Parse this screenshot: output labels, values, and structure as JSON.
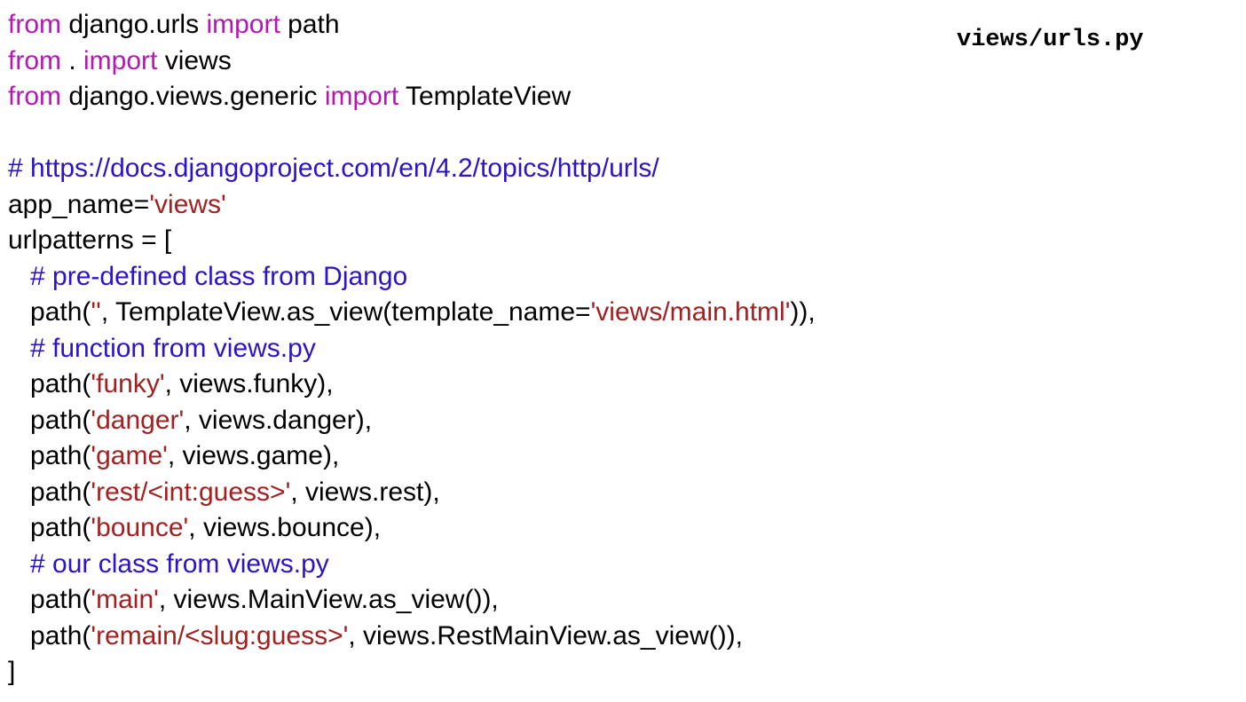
{
  "filename": "views/urls.py",
  "colors": {
    "keyword": "#b517b5",
    "comment": "#2a14c8",
    "string": "#a32020",
    "default": "#000000"
  },
  "code_lines": [
    [
      {
        "t": "from",
        "c": "kw"
      },
      {
        "t": " django.urls ",
        "c": "default"
      },
      {
        "t": "import",
        "c": "kw"
      },
      {
        "t": " path",
        "c": "default"
      }
    ],
    [
      {
        "t": "from",
        "c": "kw"
      },
      {
        "t": " . ",
        "c": "default"
      },
      {
        "t": "import",
        "c": "kw"
      },
      {
        "t": " views",
        "c": "default"
      }
    ],
    [
      {
        "t": "from",
        "c": "kw"
      },
      {
        "t": " django.views.generic ",
        "c": "default"
      },
      {
        "t": "import",
        "c": "kw"
      },
      {
        "t": " TemplateView",
        "c": "default"
      }
    ],
    [],
    [
      {
        "t": "# https://docs.djangoproject.com/en/4.2/topics/http/urls/",
        "c": "cm"
      }
    ],
    [
      {
        "t": "app_name=",
        "c": "default"
      },
      {
        "t": "'views'",
        "c": "st"
      }
    ],
    [
      {
        "t": "urlpatterns = [",
        "c": "default"
      }
    ],
    [
      {
        "t": "   ",
        "c": "default"
      },
      {
        "t": "# pre-defined class from Django",
        "c": "cm"
      }
    ],
    [
      {
        "t": "   path(",
        "c": "default"
      },
      {
        "t": "''",
        "c": "st"
      },
      {
        "t": ", TemplateView.as_view(template_name=",
        "c": "default"
      },
      {
        "t": "'views/main.html'",
        "c": "st"
      },
      {
        "t": ")),",
        "c": "default"
      }
    ],
    [
      {
        "t": "   ",
        "c": "default"
      },
      {
        "t": "# function from views.py",
        "c": "cm"
      }
    ],
    [
      {
        "t": "   path(",
        "c": "default"
      },
      {
        "t": "'funky'",
        "c": "st"
      },
      {
        "t": ", views.funky),",
        "c": "default"
      }
    ],
    [
      {
        "t": "   path(",
        "c": "default"
      },
      {
        "t": "'danger'",
        "c": "st"
      },
      {
        "t": ", views.danger),",
        "c": "default"
      }
    ],
    [
      {
        "t": "   path(",
        "c": "default"
      },
      {
        "t": "'game'",
        "c": "st"
      },
      {
        "t": ", views.game),",
        "c": "default"
      }
    ],
    [
      {
        "t": "   path(",
        "c": "default"
      },
      {
        "t": "'rest/<int:guess>'",
        "c": "st"
      },
      {
        "t": ", views.rest),",
        "c": "default"
      }
    ],
    [
      {
        "t": "   path(",
        "c": "default"
      },
      {
        "t": "'bounce'",
        "c": "st"
      },
      {
        "t": ", views.bounce),",
        "c": "default"
      }
    ],
    [
      {
        "t": "   ",
        "c": "default"
      },
      {
        "t": "# our class from views.py",
        "c": "cm"
      }
    ],
    [
      {
        "t": "   path(",
        "c": "default"
      },
      {
        "t": "'main'",
        "c": "st"
      },
      {
        "t": ", views.MainView.as_view()),",
        "c": "default"
      }
    ],
    [
      {
        "t": "   path(",
        "c": "default"
      },
      {
        "t": "'remain/<slug:guess>'",
        "c": "st"
      },
      {
        "t": ", views.RestMainView.as_view()),",
        "c": "default"
      }
    ],
    [
      {
        "t": "]",
        "c": "default"
      }
    ]
  ]
}
